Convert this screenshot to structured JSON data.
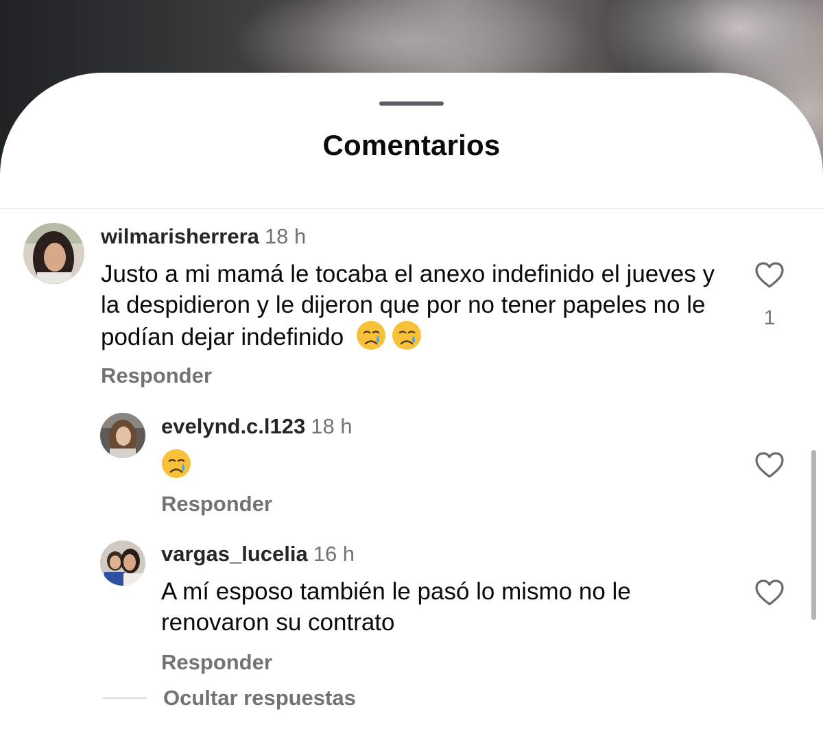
{
  "sheet": {
    "title": "Comentarios"
  },
  "comments": [
    {
      "username": "wilmarisherrera",
      "time": "18 h",
      "text": "Justo a mi mamá le tocaba el anexo indefinido el jueves y la despidieron y le dijeron que por no tener papeles no le podían dejar indefinido",
      "emoji": [
        "crying-face",
        "crying-face"
      ],
      "likes": "1",
      "reply_label": "Responder"
    },
    {
      "username": "evelynd.c.l123",
      "time": "18 h",
      "text": "",
      "emoji": [
        "crying-face"
      ],
      "reply_label": "Responder"
    },
    {
      "username": "vargas_lucelia",
      "time": "16 h",
      "text": "A mí esposo también le pasó lo mismo no le renovaron su contrato",
      "reply_label": "Responder"
    }
  ],
  "replies_toggle": {
    "label": "Ocultar respuestas"
  },
  "colors": {
    "text_primary": "#0a0a0a",
    "text_secondary": "#737373",
    "divider": "#dbdbdb",
    "emoji_yellow": "#f7c23a",
    "emoji_tear": "#4aa3e8"
  },
  "icons": {
    "like": "heart-outline-icon",
    "emoji": "crying-face-emoji"
  }
}
